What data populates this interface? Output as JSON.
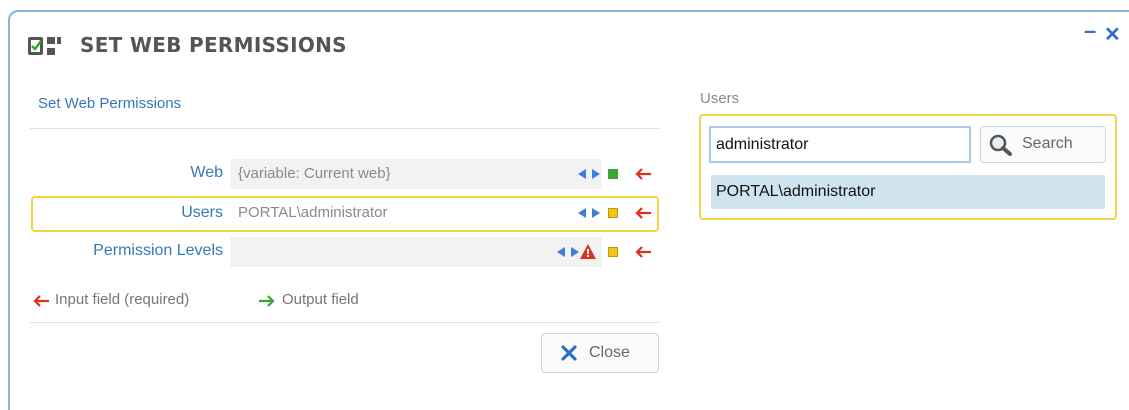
{
  "dialog": {
    "title": "SET WEB PERMISSIONS",
    "icon": "permissions-icon",
    "minimize_symbol": "–",
    "close_symbol": "✕"
  },
  "form": {
    "section_title": "Set Web Permissions",
    "fields": [
      {
        "label": "Web",
        "value": "{variable: Current web}",
        "status": "set",
        "required": true
      },
      {
        "label": "Users",
        "value": "PORTAL\\administrator",
        "status": "pending",
        "required": true,
        "selected": true
      },
      {
        "label": "Permission Levels",
        "value": "",
        "status": "pending",
        "required": true,
        "warning": true
      }
    ],
    "legend": {
      "input_label": "Input field (required)",
      "output_label": "Output field"
    },
    "close_label": "Close"
  },
  "users_panel": {
    "heading": "Users",
    "search_value": "administrator",
    "search_label": "Search",
    "results": [
      "PORTAL\\administrator"
    ]
  },
  "colors": {
    "accent_blue": "#3578b8",
    "required_arrow": "#d9321e",
    "output_arrow": "#3aa532",
    "highlight_border": "#f3d34a",
    "result_highlight": "#cfe4ee"
  }
}
